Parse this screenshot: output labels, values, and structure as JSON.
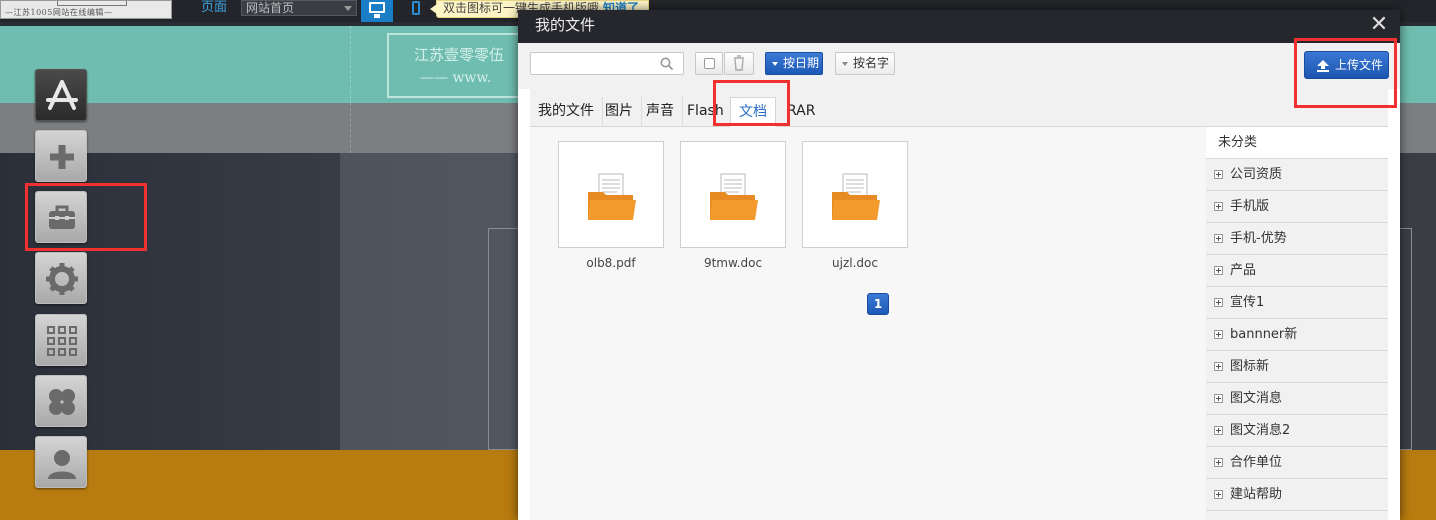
{
  "topbar": {
    "logo_text": "—江苏1005网站在线编辑—",
    "page_label": "页面",
    "page_select_value": "网站首页",
    "tooltip_text": "双击图标可一键生成手机版哦",
    "tooltip_action": "知道了"
  },
  "background": {
    "banner_text": "江苏壹零零伍",
    "banner_sub": "—— www."
  },
  "dock": {
    "items": [
      "app-store-icon",
      "add-icon",
      "toolbox-icon",
      "gear-icon",
      "grid-icon",
      "clover-icon",
      "user-icon"
    ]
  },
  "modal": {
    "title": "我的文件",
    "close_glyph": "✕",
    "toolbar": {
      "search_placeholder": "",
      "sort_date_label": "按日期",
      "sort_name_label": "按名字",
      "upload_label": "上传文件"
    },
    "tabs": [
      {
        "label": "我的文件"
      },
      {
        "label": "图片"
      },
      {
        "label": "声音"
      },
      {
        "label": "Flash"
      },
      {
        "label": "文档",
        "active": true
      },
      {
        "label": "RAR"
      }
    ],
    "files": [
      {
        "name": "olb8.pdf"
      },
      {
        "name": "9tmw.doc"
      },
      {
        "name": "ujzl.doc"
      }
    ],
    "pagination": {
      "current_page": "1"
    },
    "categories": [
      {
        "label": "未分类"
      },
      {
        "label": "公司资质"
      },
      {
        "label": "手机版"
      },
      {
        "label": "手机-优势"
      },
      {
        "label": "产品"
      },
      {
        "label": "宣传1"
      },
      {
        "label": "bannner新"
      },
      {
        "label": "图标新"
      },
      {
        "label": "图文消息"
      },
      {
        "label": "图文消息2"
      },
      {
        "label": "合作单位"
      },
      {
        "label": "建站帮助"
      }
    ]
  },
  "colors": {
    "accent_blue": "#1d59b6",
    "highlight_red": "#f23030",
    "teal": "#6fbdb0",
    "orange": "#b77b0f"
  }
}
